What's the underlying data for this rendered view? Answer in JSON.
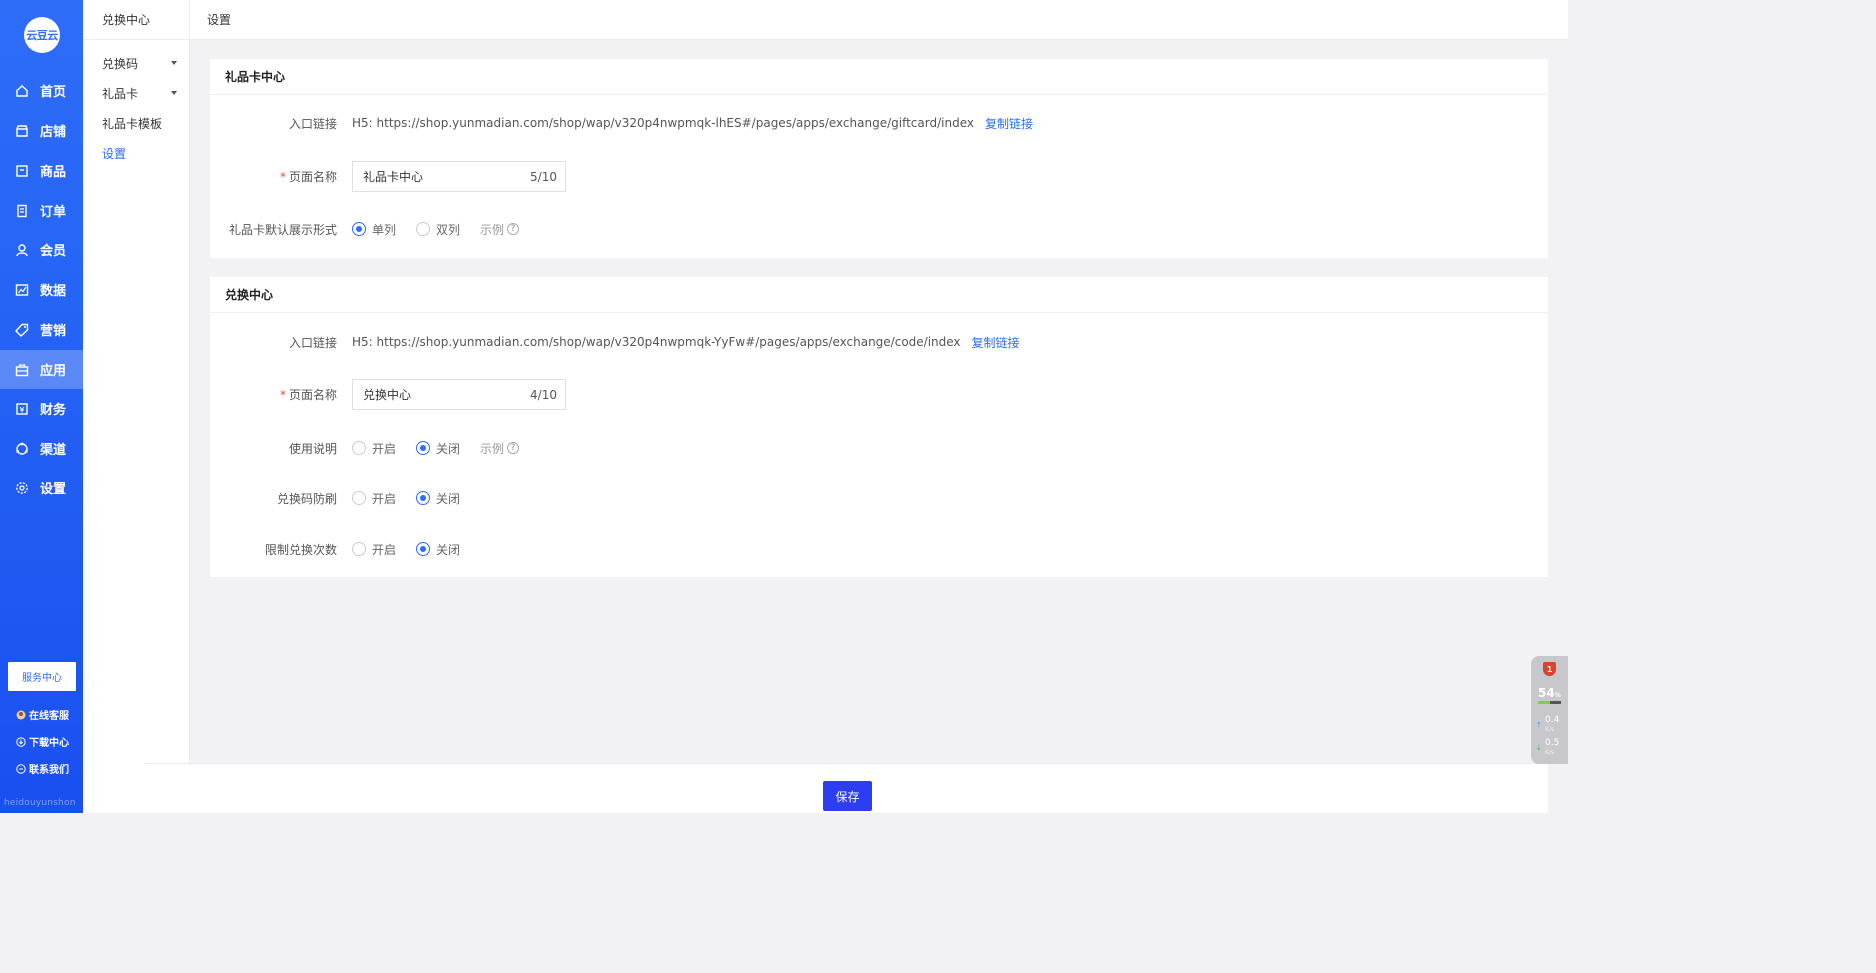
{
  "sidebar": {
    "logo_text": "云豆云",
    "nav": [
      {
        "label": "首页",
        "icon": "home-icon"
      },
      {
        "label": "店铺",
        "icon": "store-icon"
      },
      {
        "label": "商品",
        "icon": "product-icon"
      },
      {
        "label": "订单",
        "icon": "order-icon"
      },
      {
        "label": "会员",
        "icon": "member-icon"
      },
      {
        "label": "数据",
        "icon": "chart-icon"
      },
      {
        "label": "营销",
        "icon": "tag-icon"
      },
      {
        "label": "应用",
        "icon": "app-icon",
        "active": true
      },
      {
        "label": "财务",
        "icon": "finance-icon"
      },
      {
        "label": "渠道",
        "icon": "channel-icon"
      },
      {
        "label": "设置",
        "icon": "gear-icon"
      }
    ],
    "service_center": "服务中心",
    "online_service": "在线客服",
    "download_center": "下载中心",
    "contact_us": "联系我们",
    "watermark": "heidouyunshon"
  },
  "submenu": {
    "title": "兑换中心",
    "items": [
      {
        "label": "兑换码",
        "has_caret": true
      },
      {
        "label": "礼品卡",
        "has_caret": true
      },
      {
        "label": "礼品卡模板",
        "has_caret": false
      },
      {
        "label": "设置",
        "has_caret": false,
        "active": true
      }
    ]
  },
  "header": {
    "title": "设置"
  },
  "giftcard": {
    "title": "礼品卡中心",
    "entry_label": "入口链接",
    "entry_url": "H5: https://shop.yunmadian.com/shop/wap/v320p4nwpmqk-lhES#/pages/apps/exchange/giftcard/index",
    "copy_label": "复制链接",
    "name_label": "页面名称",
    "name_value": "礼品卡中心",
    "name_count": "5/10",
    "display_label": "礼品卡默认展示形式",
    "display_options": [
      "单列",
      "双列"
    ],
    "display_selected": "单列",
    "example_label": "示例"
  },
  "exchange": {
    "title": "兑换中心",
    "entry_label": "入口链接",
    "entry_url": "H5: https://shop.yunmadian.com/shop/wap/v320p4nwpmqk-YyFw#/pages/apps/exchange/code/index",
    "copy_label": "复制链接",
    "name_label": "页面名称",
    "name_value": "兑换中心",
    "name_count": "4/10",
    "usage_label": "使用说明",
    "antibrush_label": "兑换码防刷",
    "limit_label": "限制兑换次数",
    "on_label": "开启",
    "off_label": "关闭",
    "usage_selected": "关闭",
    "antibrush_selected": "关闭",
    "limit_selected": "关闭",
    "example_label": "示例"
  },
  "footer": {
    "save_label": "保存"
  },
  "monitor": {
    "alert_count": "1",
    "cpu_percent": "54",
    "cpu_unit": "%",
    "cpu_fill_fraction": 0.54,
    "upload": "0.4",
    "download": "0.5",
    "speed_unit": "K/s"
  },
  "colors": {
    "accent": "#2d6df8",
    "sidebar": "#2563f5",
    "save_button": "#2d3ef0",
    "required": "#e54d42"
  }
}
